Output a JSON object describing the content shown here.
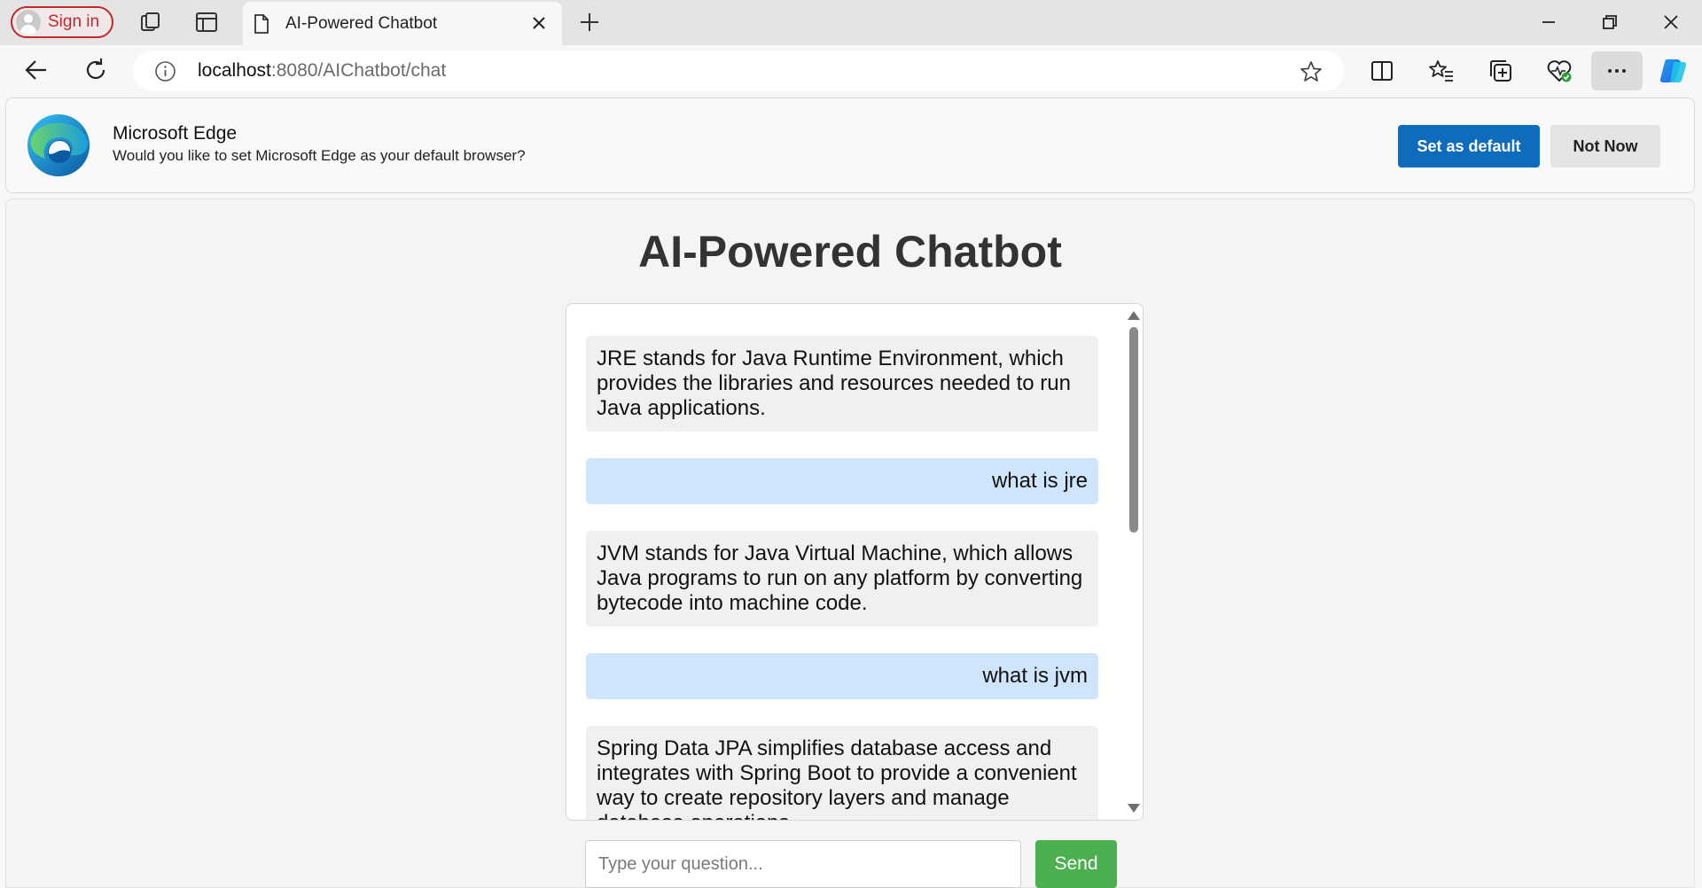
{
  "browser": {
    "signin_label": "Sign in",
    "tab_title": "AI-Powered Chatbot",
    "address_host": "localhost",
    "address_path": ":8080/AIChatbot/chat"
  },
  "infobar": {
    "title": "Microsoft Edge",
    "message": "Would you like to set Microsoft Edge as your default browser?",
    "set_default_label": "Set as default",
    "not_now_label": "Not Now"
  },
  "page": {
    "title": "AI-Powered Chatbot",
    "messages": [
      {
        "role": "bot",
        "text": "JRE stands for Java Runtime Environment, which provides the libraries and resources needed to run Java applications."
      },
      {
        "role": "user",
        "text": "what is jre"
      },
      {
        "role": "bot",
        "text": "JVM stands for Java Virtual Machine, which allows Java programs to run on any platform by converting bytecode into machine code."
      },
      {
        "role": "user",
        "text": "what is jvm"
      },
      {
        "role": "bot",
        "text": "Spring Data JPA simplifies database access and integrates with Spring Boot to provide a convenient way to create repository layers and manage database operations."
      }
    ],
    "input_placeholder": "Type your question...",
    "send_label": "Send"
  }
}
